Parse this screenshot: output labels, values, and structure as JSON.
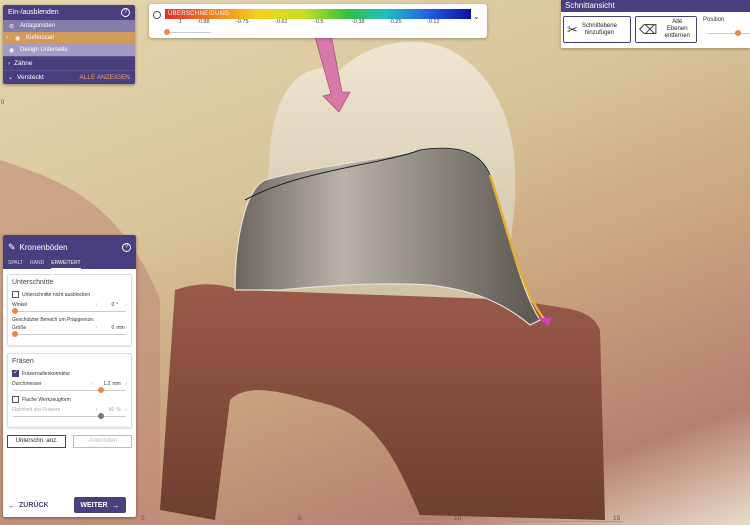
{
  "colorscale": {
    "title": "ÜBERSCHNEIDUNG",
    "ticks": [
      "-1",
      "-0.88",
      "-0.75",
      "-0.62",
      "-0.5",
      "-0.38",
      "-0.25",
      "-0.12"
    ]
  },
  "visibility": {
    "header": "Ein-/ausblenden",
    "items": [
      {
        "label": "Antagonisten"
      },
      {
        "label": "Kieferscan"
      },
      {
        "label": "Design Unterseite"
      }
    ],
    "rows": [
      {
        "label": "Zähne"
      },
      {
        "label": "Versteckt",
        "action": "ALLE ANZEIGEN"
      }
    ]
  },
  "krone": {
    "title": "Kronenböden",
    "tabs": [
      "SPALT",
      "RAND",
      "ERWEITERT"
    ],
    "unterschnitte": {
      "title": "Unterschnitte",
      "checkbox_label": "Unterschnitte nicht ausblocken",
      "winkel_label": "Winkel",
      "winkel_value": "0",
      "winkel_unit": "°",
      "bereich_label": "Geschützter Bereich um Präpgrenze:",
      "groesse_label": "Größe",
      "groesse_value": "0",
      "groesse_unit": "mm"
    },
    "fraesen": {
      "title": "Fräsen",
      "checkbox_label": "Fräserradienkorrektur",
      "durchmesser_label": "Durchmesser",
      "durchmesser_value": "1.2",
      "durchmesser_unit": "mm",
      "flach_label": "Flache Werkzeugform",
      "flachheit_label": "Flachheit des Fräsers",
      "flachheit_value": "80",
      "flachheit_unit": "%"
    },
    "buttons": {
      "show_label": "Unterschn. anz.",
      "apply_label": "Anwenden",
      "back_label": "ZURÜCK",
      "next_label": "WEITER"
    }
  },
  "cutview": {
    "title": "Schnittansicht",
    "add_label_1": "Schnittebene",
    "add_label_2": "hinzufügen",
    "remove_label_1": "Alle Ebenen",
    "remove_label_2": "entfernen",
    "position_label": "Position"
  },
  "axis": {
    "labels": [
      "0",
      "5",
      "10",
      "15"
    ],
    "left_label": "0"
  },
  "colors": {
    "accent": "#4a3f7e",
    "slider": "#e8894a"
  }
}
